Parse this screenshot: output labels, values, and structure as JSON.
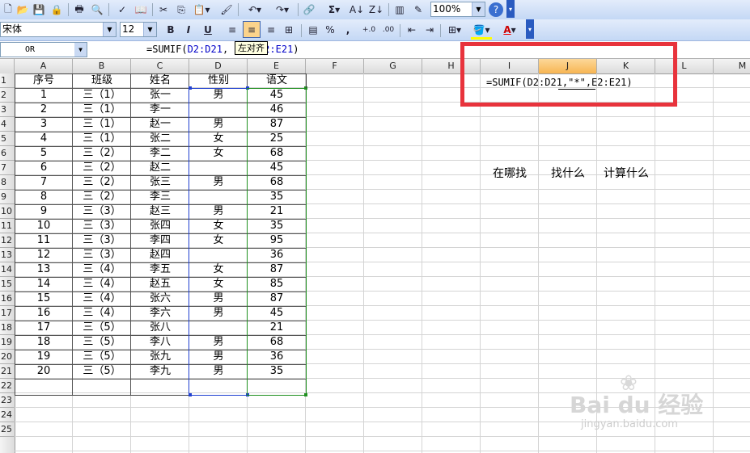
{
  "toolbar": {
    "zoom": "100%",
    "font_name": "宋体",
    "font_size": "12",
    "bold": "B",
    "italic": "I",
    "underline": "U",
    "percent": "%",
    "comma": ",",
    "sum": "Σ",
    "font_color_letter": "A",
    "tooltip": "左对齐"
  },
  "formula_bar": {
    "name_box": "OR",
    "formula_prefix": "=SUMIF(",
    "formula_ref1": "D2:D21",
    "formula_comma": ",",
    "formula_ref2": "2:E21",
    "formula_suffix": ")"
  },
  "columns": [
    "A",
    "B",
    "C",
    "D",
    "E",
    "F",
    "G",
    "H",
    "I",
    "J",
    "K",
    "L",
    "M"
  ],
  "rows": [
    "1",
    "2",
    "3",
    "4",
    "5",
    "6",
    "7",
    "8",
    "9",
    "10",
    "11",
    "12",
    "13",
    "14",
    "15",
    "16",
    "17",
    "18",
    "19",
    "20",
    "21",
    "22",
    "23",
    "24",
    "25"
  ],
  "headers": [
    "序号",
    "班级",
    "姓名",
    "性别",
    "语文"
  ],
  "table": [
    [
      "1",
      "三（1）",
      "张一",
      "男",
      "45"
    ],
    [
      "2",
      "三（1）",
      "李一",
      "",
      "46"
    ],
    [
      "3",
      "三（1）",
      "赵一",
      "男",
      "87"
    ],
    [
      "4",
      "三（1）",
      "张二",
      "女",
      "25"
    ],
    [
      "5",
      "三（2）",
      "李二",
      "女",
      "68"
    ],
    [
      "6",
      "三（2）",
      "赵二",
      "",
      "45"
    ],
    [
      "7",
      "三（2）",
      "张三",
      "男",
      "68"
    ],
    [
      "8",
      "三（2）",
      "李三",
      "",
      "35"
    ],
    [
      "9",
      "三（3）",
      "赵三",
      "男",
      "21"
    ],
    [
      "10",
      "三（3）",
      "张四",
      "女",
      "35"
    ],
    [
      "11",
      "三（3）",
      "李四",
      "女",
      "95"
    ],
    [
      "12",
      "三（3）",
      "赵四",
      "",
      "36"
    ],
    [
      "13",
      "三（4）",
      "李五",
      "女",
      "87"
    ],
    [
      "14",
      "三（4）",
      "赵五",
      "女",
      "85"
    ],
    [
      "15",
      "三（4）",
      "张六",
      "男",
      "87"
    ],
    [
      "16",
      "三（4）",
      "李六",
      "男",
      "45"
    ],
    [
      "17",
      "三（5）",
      "张八",
      "",
      "21"
    ],
    [
      "18",
      "三（5）",
      "李八",
      "男",
      "68"
    ],
    [
      "19",
      "三（5）",
      "张九",
      "男",
      "36"
    ],
    [
      "20",
      "三（5）",
      "李九",
      "男",
      "35"
    ]
  ],
  "cell_formula": "=SUMIF(D2:D21,\"*\",E2:E21)",
  "labels": {
    "where": "在哪找",
    "what": "找什么",
    "calc": "计算什么"
  },
  "watermark": {
    "brand": "Bai du 经验",
    "site": "jingyan.baidu.com"
  },
  "colors": {
    "red_box": "#e8333c",
    "selected_header": "#f7b552",
    "ref_blue": "#0000c8"
  }
}
